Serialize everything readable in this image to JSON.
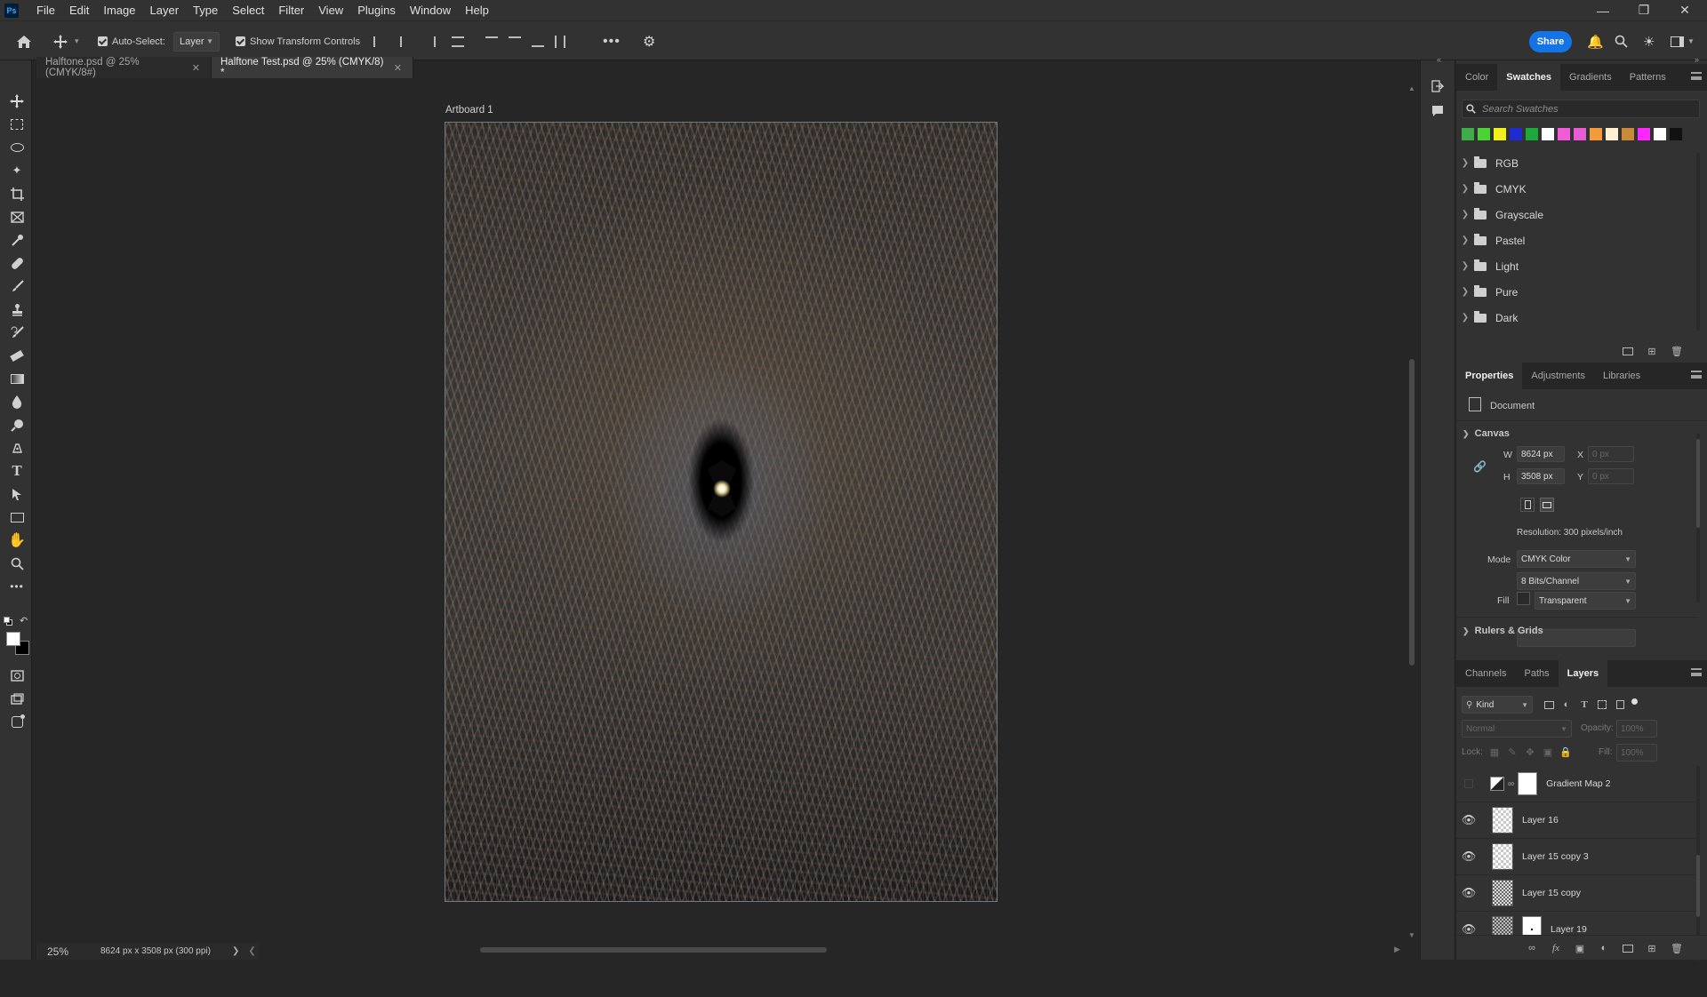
{
  "app": {
    "logo": "Ps"
  },
  "menu": [
    "File",
    "Edit",
    "Image",
    "Layer",
    "Type",
    "Select",
    "Filter",
    "View",
    "Plugins",
    "Window",
    "Help"
  ],
  "options_bar": {
    "auto_select_label": "Auto-Select:",
    "auto_select_value": "Layer",
    "transform_controls_label": "Show Transform Controls",
    "share_label": "Share"
  },
  "tabs": [
    {
      "label": "Halftone.psd @ 25% (CMYK/8#)",
      "active": false
    },
    {
      "label": "Halftone Test.psd @ 25% (CMYK/8) *",
      "active": true
    }
  ],
  "canvas": {
    "artboard_title": "Artboard 1"
  },
  "status": {
    "zoom": "25%",
    "doc_info": "8624 px x 3508 px (300 ppi)"
  },
  "swatches_panel": {
    "tabs": [
      "Color",
      "Swatches",
      "Gradients",
      "Patterns"
    ],
    "active_tab": "Swatches",
    "search_placeholder": "Search Swatches",
    "recent_colors": [
      "#3fae49",
      "#4cd137",
      "#f0f01a",
      "#1f2bd1",
      "#1fa83a",
      "#ffffff",
      "#f05bd8",
      "#e85cd6",
      "#f39a3a",
      "#fff0d0",
      "#c98a3a",
      "#ff29ff",
      "#ffffff",
      "#111111"
    ],
    "folders": [
      "RGB",
      "CMYK",
      "Grayscale",
      "Pastel",
      "Light",
      "Pure",
      "Dark"
    ]
  },
  "properties_panel": {
    "tabs": [
      "Properties",
      "Adjustments",
      "Libraries"
    ],
    "active_tab": "Properties",
    "section_type": "Document",
    "canvas_header": "Canvas",
    "w_label": "W",
    "w_value": "8624 px",
    "h_label": "H",
    "h_value": "3508 px",
    "x_label": "X",
    "x_value": "0 px",
    "y_label": "Y",
    "y_value": "0 px",
    "resolution": "Resolution: 300 pixels/inch",
    "mode_label": "Mode",
    "mode_value": "CMYK Color",
    "bits_value": "8 Bits/Channel",
    "fill_label": "Fill",
    "fill_value": "Transparent",
    "rulers_header": "Rulers & Grids"
  },
  "layers_panel": {
    "tabs": [
      "Channels",
      "Paths",
      "Layers"
    ],
    "active_tab": "Layers",
    "kind_label": "Kind",
    "blend_mode": "Normal",
    "opacity_label": "Opacity:",
    "opacity_value": "100%",
    "lock_label": "Lock:",
    "fill_label": "Fill:",
    "fill_value": "100%",
    "layers": [
      {
        "name": "Gradient Map 2",
        "visible": false,
        "type": "adjustment"
      },
      {
        "name": "Layer 16",
        "visible": true,
        "type": "pixel"
      },
      {
        "name": "Layer 15 copy 3",
        "visible": true,
        "type": "pixel"
      },
      {
        "name": "Layer 15 copy",
        "visible": true,
        "type": "pixel"
      },
      {
        "name": "Layer 19",
        "visible": true,
        "type": "masked"
      }
    ]
  }
}
